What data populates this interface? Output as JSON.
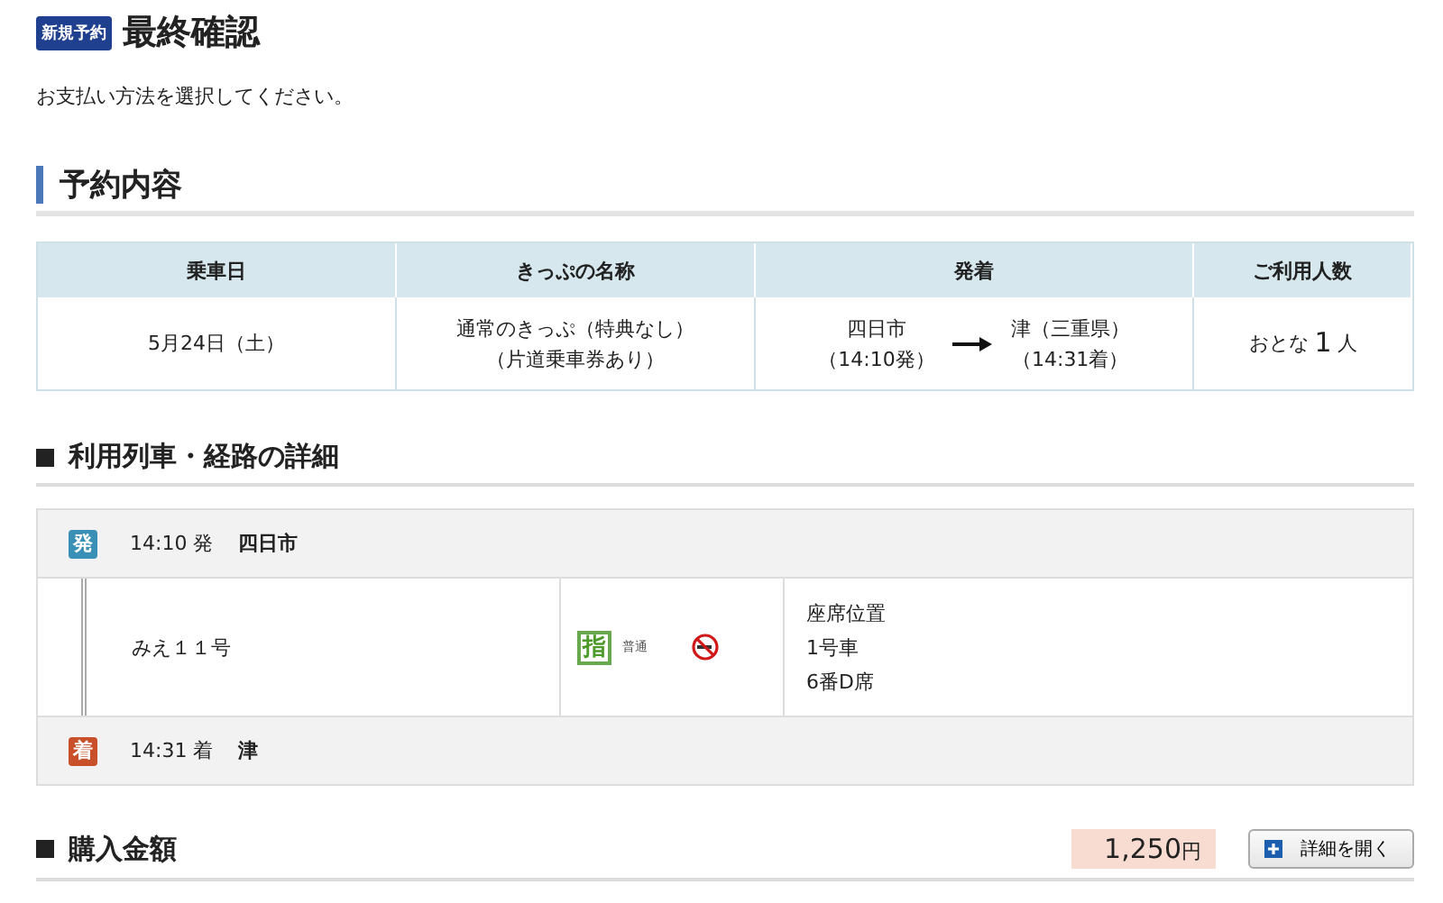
{
  "page": {
    "badge": "新規予約",
    "title": "最終確認",
    "instruction": "お支払い方法を選択してください。"
  },
  "reservation": {
    "heading": "予約内容",
    "columns": [
      "乗車日",
      "きっぷの名称",
      "発着",
      "ご利用人数"
    ],
    "row": {
      "date": "5月24日（土）",
      "ticket_name": [
        "通常のきっぷ（特典なし）",
        "（片道乗車券あり）"
      ],
      "from": {
        "station": "四日市",
        "time": "（14:10発）"
      },
      "to": {
        "station": "津（三重県）",
        "time": "（14:31着）"
      },
      "passengers": {
        "label": "おとな",
        "count": "1",
        "unit": "人"
      }
    }
  },
  "route": {
    "heading": "利用列車・経路の詳細",
    "stops": [
      {
        "kind": "departure",
        "badge": "発",
        "time": "14:10 発",
        "station": "四日市"
      },
      {
        "kind": "arrival",
        "badge": "着",
        "time": "14:31 着",
        "station": "津"
      }
    ],
    "train": {
      "name": "みえ１１号",
      "seat_badge": "指",
      "car_type": "普通",
      "non_smoking": true,
      "seat": [
        "座席位置",
        "1号車",
        "6番D席"
      ]
    }
  },
  "price": {
    "heading": "購入金額",
    "amount": "1,250",
    "unit": "円",
    "button": "詳細を開く"
  }
}
